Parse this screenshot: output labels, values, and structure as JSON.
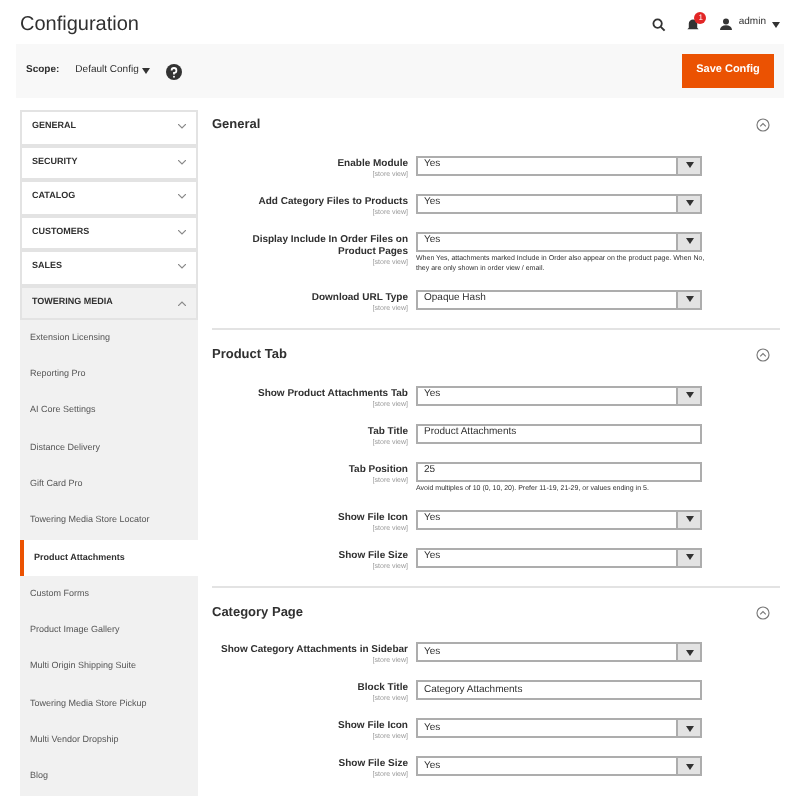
{
  "page_title": "Configuration",
  "header": {
    "notifications": "1",
    "user": "admin"
  },
  "scope": {
    "label": "Scope:",
    "value": "Default Config"
  },
  "save_button": "Save Config",
  "sidebar": [
    {
      "label": "GENERAL",
      "expanded": false
    },
    {
      "label": "SECURITY",
      "expanded": false
    },
    {
      "label": "CATALOG",
      "expanded": false
    },
    {
      "label": "CUSTOMERS",
      "expanded": false
    },
    {
      "label": "SALES",
      "expanded": false
    },
    {
      "label": "TOWERING MEDIA",
      "expanded": true,
      "children": [
        {
          "label": "Extension Licensing",
          "selected": false
        },
        {
          "label": "Reporting Pro",
          "selected": false
        },
        {
          "label": "AI Core Settings",
          "selected": false
        },
        {
          "label": "Distance Delivery",
          "selected": false
        },
        {
          "label": "Gift Card Pro",
          "selected": false
        },
        {
          "label": "Towering Media Store Locator",
          "selected": false
        },
        {
          "label": "Product Attachments",
          "selected": true
        },
        {
          "label": "Custom Forms",
          "selected": false
        },
        {
          "label": "Product Image Gallery",
          "selected": false
        },
        {
          "label": "Multi Origin Shipping Suite",
          "selected": false
        },
        {
          "label": "Towering Media Store Pickup",
          "selected": false
        },
        {
          "label": "Multi Vendor Dropship",
          "selected": false
        },
        {
          "label": "Blog",
          "selected": false
        }
      ]
    }
  ],
  "sections": [
    {
      "title": "General",
      "fields": [
        {
          "kind": "select",
          "label": "Enable Module",
          "scope": "[store view]",
          "value": "Yes"
        },
        {
          "kind": "select",
          "label": "Add Category Files to Products",
          "scope": "[store view]",
          "value": "Yes"
        },
        {
          "kind": "select",
          "label": "Display Include In Order Files on Product Pages",
          "scope": "[store view]",
          "value": "Yes",
          "note": "When Yes, attachments marked Include in Order also appear on the product page. When No, they are only shown in order view / email."
        },
        {
          "kind": "select",
          "label": "Download URL Type",
          "scope": "[store view]",
          "value": "Opaque Hash"
        }
      ]
    },
    {
      "title": "Product Tab",
      "fields": [
        {
          "kind": "select",
          "label": "Show Product Attachments Tab",
          "scope": "[store view]",
          "value": "Yes"
        },
        {
          "kind": "text",
          "label": "Tab Title",
          "scope": "[store view]",
          "value": "Product Attachments"
        },
        {
          "kind": "text",
          "label": "Tab Position",
          "scope": "[store view]",
          "value": "25",
          "note": "Avoid multiples of 10 (0, 10, 20). Prefer 11-19, 21-29, or values ending in 5."
        },
        {
          "kind": "select",
          "label": "Show File Icon",
          "scope": "[store view]",
          "value": "Yes"
        },
        {
          "kind": "select",
          "label": "Show File Size",
          "scope": "[store view]",
          "value": "Yes"
        }
      ]
    },
    {
      "title": "Category Page",
      "fields": [
        {
          "kind": "select",
          "label": "Show Category Attachments in Sidebar",
          "scope": "[store view]",
          "value": "Yes"
        },
        {
          "kind": "text",
          "label": "Block Title",
          "scope": "[store view]",
          "value": "Category Attachments"
        },
        {
          "kind": "select",
          "label": "Show File Icon",
          "scope": "[store view]",
          "value": "Yes"
        },
        {
          "kind": "select",
          "label": "Show File Size",
          "scope": "[store view]",
          "value": "Yes"
        }
      ]
    }
  ]
}
